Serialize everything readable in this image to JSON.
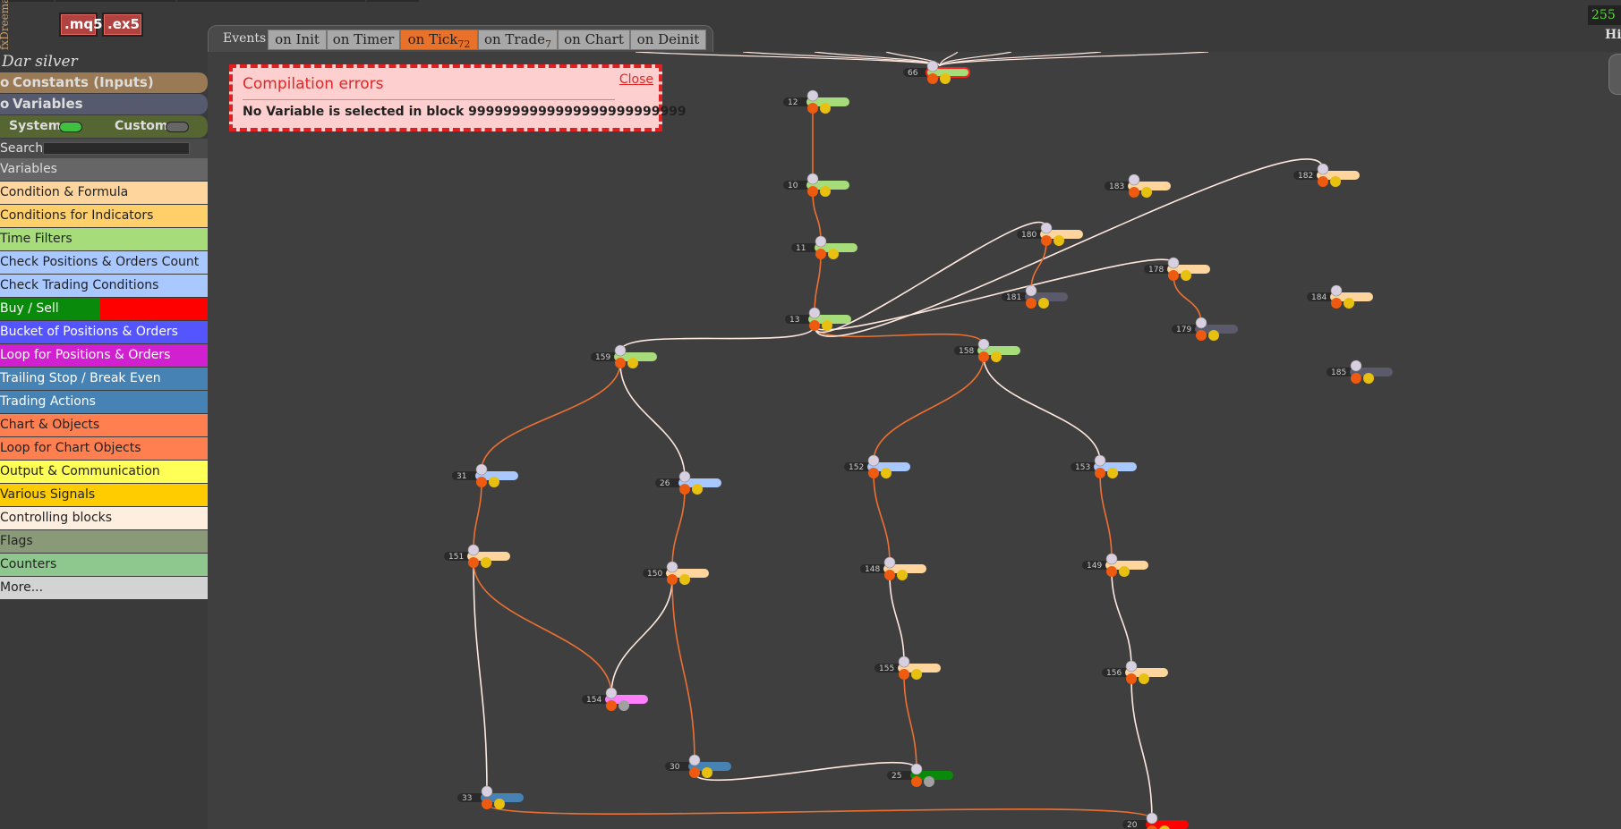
{
  "app": {
    "side_label": "fxDreema",
    "counter": "255",
    "header_right": "His"
  },
  "files": {
    "mq5": ".mq5",
    "ex5": ".ex5"
  },
  "events": {
    "label": "Events",
    "tabs": [
      {
        "label": "on Init",
        "count": ""
      },
      {
        "label": "on Timer",
        "count": ""
      },
      {
        "label": "on Tick",
        "count": "72",
        "active": true
      },
      {
        "label": "on Trade",
        "count": "7"
      },
      {
        "label": "on Chart",
        "count": ""
      },
      {
        "label": "on Deinit",
        "count": ""
      }
    ]
  },
  "sidebar": {
    "project_name": "Dar silver",
    "constants": "Constants (Inputs)",
    "variables_head": "Variables",
    "system_label": "System",
    "custom_label": "Custom",
    "search_label": "Search:",
    "search_value": "",
    "categories": [
      {
        "label": "Variables",
        "bg": "#666666",
        "fg": "#dddddd"
      },
      {
        "label": "Condition & Formula",
        "bg": "#ffd59e",
        "fg": "#222222"
      },
      {
        "label": "Conditions for Indicators",
        "bg": "#ffd06a",
        "fg": "#222222"
      },
      {
        "label": "Time Filters",
        "bg": "#a6dd7a",
        "fg": "#222222"
      },
      {
        "label": "Check Positions & Orders Count",
        "bg": "#a8c8ff",
        "fg": "#222222"
      },
      {
        "label": "Check Trading Conditions",
        "bg": "#a8c8ff",
        "fg": "#222222"
      },
      {
        "label": "Buy / Sell",
        "bg": "#0a8a0a",
        "fg": "#ffffff",
        "bg2": "#ff0000"
      },
      {
        "label": "Bucket of Positions & Orders",
        "bg": "#5555ff",
        "fg": "#ffffff"
      },
      {
        "label": "Loop for Positions & Orders",
        "bg": "#d020d0",
        "fg": "#ffffff"
      },
      {
        "label": "Trailing Stop / Break Even",
        "bg": "#4682b4",
        "fg": "#ffffff"
      },
      {
        "label": "Trading Actions",
        "bg": "#4682b4",
        "fg": "#ffffff"
      },
      {
        "label": "Chart & Objects",
        "bg": "#ff7f50",
        "fg": "#222222"
      },
      {
        "label": "Loop for Chart Objects",
        "bg": "#ff7f50",
        "fg": "#222222"
      },
      {
        "label": "Output & Communication",
        "bg": "#ffff55",
        "fg": "#222222"
      },
      {
        "label": "Various Signals",
        "bg": "#ffcc00",
        "fg": "#222222"
      },
      {
        "label": "Controlling blocks",
        "bg": "#fdeee0",
        "fg": "#222222"
      },
      {
        "label": "Flags",
        "bg": "#8a9a78",
        "fg": "#222222"
      },
      {
        "label": "Counters",
        "bg": "#8fc88f",
        "fg": "#222222"
      },
      {
        "label": "More...",
        "bg": "#d3d3d3",
        "fg": "#222222"
      }
    ]
  },
  "error": {
    "title": "Compilation errors",
    "close": "Close",
    "message": "No Variable is selected in block 9999999999999999999999999"
  },
  "colors": {
    "cond": "#ffd59e",
    "time": "#a6dd7a",
    "check": "#a8c8ff",
    "loop": "#ff80ff",
    "trail": "#4682b4",
    "buy": "#0a8a0a",
    "sell": "#ff0000",
    "var": "#5a5a6a",
    "wire_orange": "#ee7030",
    "wire_white": "#ffe8e0"
  },
  "graph": {
    "blocks": [
      {
        "id": "66",
        "color": "time",
        "error": true
      },
      {
        "id": "12",
        "color": "time"
      },
      {
        "id": "10",
        "color": "time"
      },
      {
        "id": "11",
        "color": "time"
      },
      {
        "id": "13",
        "color": "time"
      },
      {
        "id": "159",
        "color": "time"
      },
      {
        "id": "158",
        "color": "time"
      },
      {
        "id": "183",
        "color": "cond"
      },
      {
        "id": "182",
        "color": "cond"
      },
      {
        "id": "180",
        "color": "cond"
      },
      {
        "id": "178",
        "color": "cond"
      },
      {
        "id": "181",
        "color": "var"
      },
      {
        "id": "179",
        "color": "var"
      },
      {
        "id": "184",
        "color": "cond"
      },
      {
        "id": "185",
        "color": "var"
      },
      {
        "id": "31",
        "color": "check"
      },
      {
        "id": "26",
        "color": "check"
      },
      {
        "id": "152",
        "color": "check"
      },
      {
        "id": "153",
        "color": "check"
      },
      {
        "id": "151",
        "color": "cond"
      },
      {
        "id": "150",
        "color": "cond"
      },
      {
        "id": "148",
        "color": "cond"
      },
      {
        "id": "149",
        "color": "cond"
      },
      {
        "id": "155",
        "color": "cond"
      },
      {
        "id": "156",
        "color": "cond"
      },
      {
        "id": "154",
        "color": "loop"
      },
      {
        "id": "30",
        "color": "trail"
      },
      {
        "id": "25",
        "color": "buy"
      },
      {
        "id": "33",
        "color": "trail"
      },
      {
        "id": "20",
        "color": "sell"
      }
    ],
    "links": [
      {
        "from": "12",
        "to": "10",
        "t": "orange"
      },
      {
        "from": "10",
        "to": "11",
        "t": "orange"
      },
      {
        "from": "11",
        "to": "13",
        "t": "orange"
      },
      {
        "from": "13",
        "to": "159",
        "t": "white"
      },
      {
        "from": "13",
        "to": "158",
        "t": "orange"
      },
      {
        "from": "13",
        "to": "180",
        "t": "white"
      },
      {
        "from": "13",
        "to": "182",
        "t": "white"
      },
      {
        "from": "13",
        "to": "178",
        "t": "white"
      },
      {
        "from": "180",
        "to": "181",
        "t": "orange"
      },
      {
        "from": "178",
        "to": "179",
        "t": "orange"
      },
      {
        "from": "159",
        "to": "31",
        "t": "orange"
      },
      {
        "from": "159",
        "to": "26",
        "t": "white"
      },
      {
        "from": "158",
        "to": "152",
        "t": "orange"
      },
      {
        "from": "158",
        "to": "153",
        "t": "white"
      },
      {
        "from": "31",
        "to": "151",
        "t": "orange"
      },
      {
        "from": "26",
        "to": "150",
        "t": "orange"
      },
      {
        "from": "152",
        "to": "148",
        "t": "orange"
      },
      {
        "from": "153",
        "to": "149",
        "t": "orange"
      },
      {
        "from": "151",
        "to": "33",
        "t": "white"
      },
      {
        "from": "151",
        "to": "154",
        "t": "orange"
      },
      {
        "from": "150",
        "to": "154",
        "t": "white"
      },
      {
        "from": "150",
        "to": "30",
        "t": "orange"
      },
      {
        "from": "148",
        "to": "155",
        "t": "white"
      },
      {
        "from": "149",
        "to": "156",
        "t": "white"
      },
      {
        "from": "155",
        "to": "25",
        "t": "orange"
      },
      {
        "from": "30",
        "to": "25",
        "t": "white"
      },
      {
        "from": "156",
        "to": "20",
        "t": "white"
      },
      {
        "from": "33",
        "to": "20",
        "t": "orange"
      }
    ]
  }
}
